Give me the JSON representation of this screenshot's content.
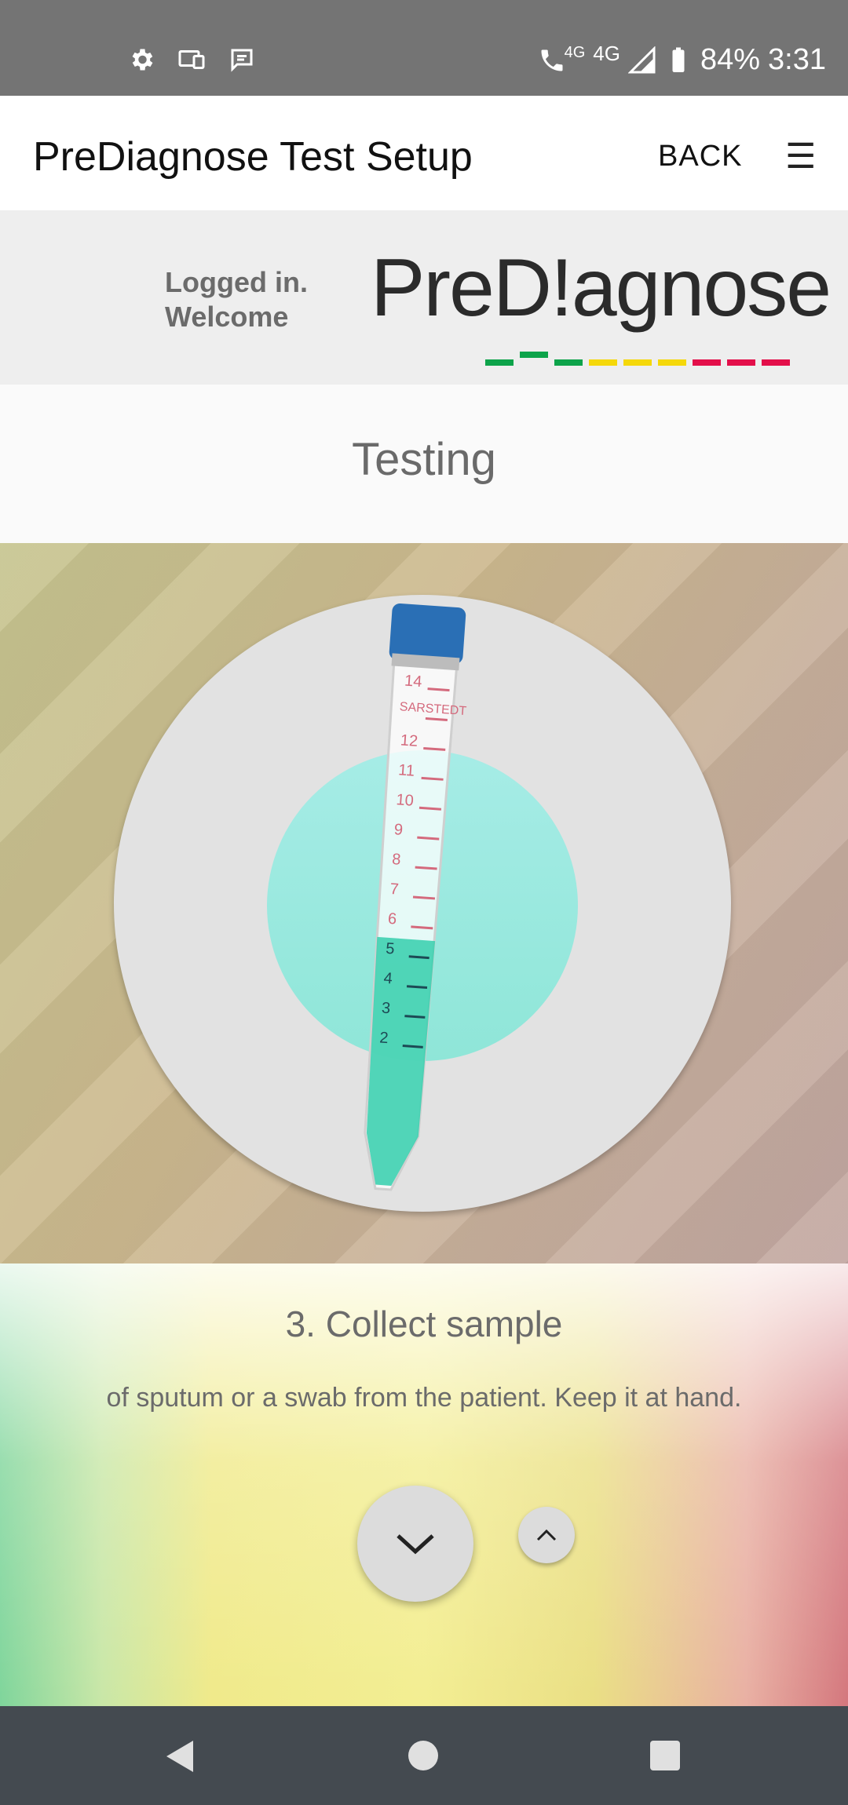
{
  "status_bar": {
    "battery": "84%",
    "time": "3:31",
    "network": "4G",
    "call_network": "4G",
    "left_icons": [
      "gear-icon",
      "cast-icon",
      "message-icon"
    ]
  },
  "app_bar": {
    "title": "PreDiagnose Test Setup",
    "back_label": "BACK",
    "menu_icon": "☰"
  },
  "brand": {
    "welcome_line1": "Logged in.",
    "welcome_line2": "Welcome",
    "logo_text": "PreD!agnose",
    "colors": {
      "green": "#0da34a",
      "yellow": "#f5d80a",
      "red": "#e30f4a"
    }
  },
  "section": {
    "title": "Testing"
  },
  "step": {
    "title": "3. Collect sample",
    "description": "of sputum or a swab from the patient. Keep it at hand.",
    "tube_labels": [
      "14",
      "12",
      "11",
      "10",
      "9",
      "8",
      "7",
      "6",
      "5",
      "4",
      "3",
      "2"
    ],
    "tube_brand": "SARSTEDT"
  }
}
